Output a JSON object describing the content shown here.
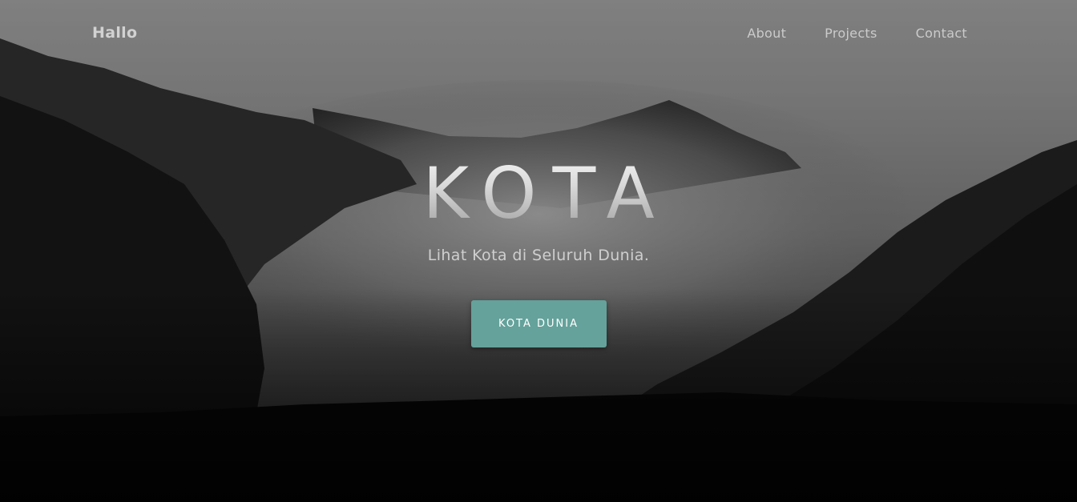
{
  "nav": {
    "brand": "Hallo",
    "links": [
      "About",
      "Projects",
      "Contact"
    ]
  },
  "hero": {
    "title": "KOTA",
    "subtitle": "Lihat Kota di Seluruh Dunia.",
    "cta_label": "KOTA DUNIA"
  },
  "colors": {
    "accent": "#64a29b",
    "nav_text": "#cbcbcb",
    "background_top": "#8a8a8a",
    "background_bottom": "#0c0c0c"
  }
}
